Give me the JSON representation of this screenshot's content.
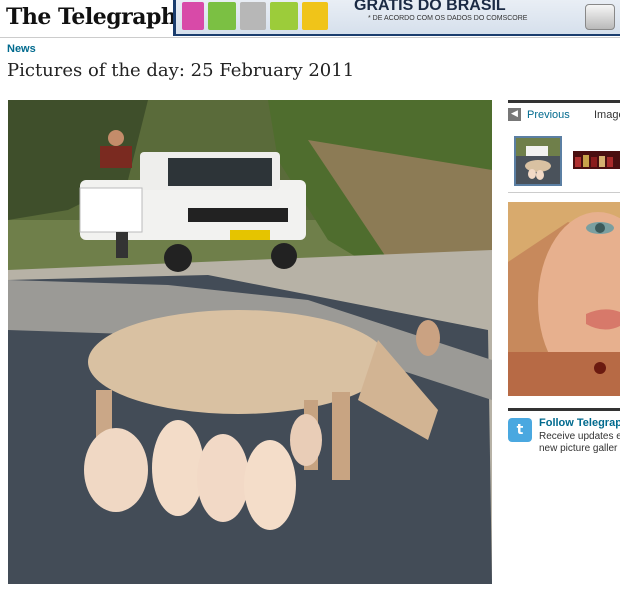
{
  "header": {
    "logo": "The Telegraph",
    "ad": {
      "headline": "GRATIS DO BRASIL",
      "subtext": "* DE ACORDO COM OS DADOS DO COMSCORE"
    }
  },
  "article": {
    "section": "News",
    "title": "Pictures of the day: 25 February 2011"
  },
  "gallery": {
    "previous_label": "Previous",
    "image_label": "Image"
  },
  "follow": {
    "title": "Follow Telegraph",
    "line1": "Receive updates ev",
    "line2": "new picture galler"
  },
  "colors": {
    "link": "#006a8e",
    "rule": "#333333",
    "twitter": "#4aa8e0"
  }
}
